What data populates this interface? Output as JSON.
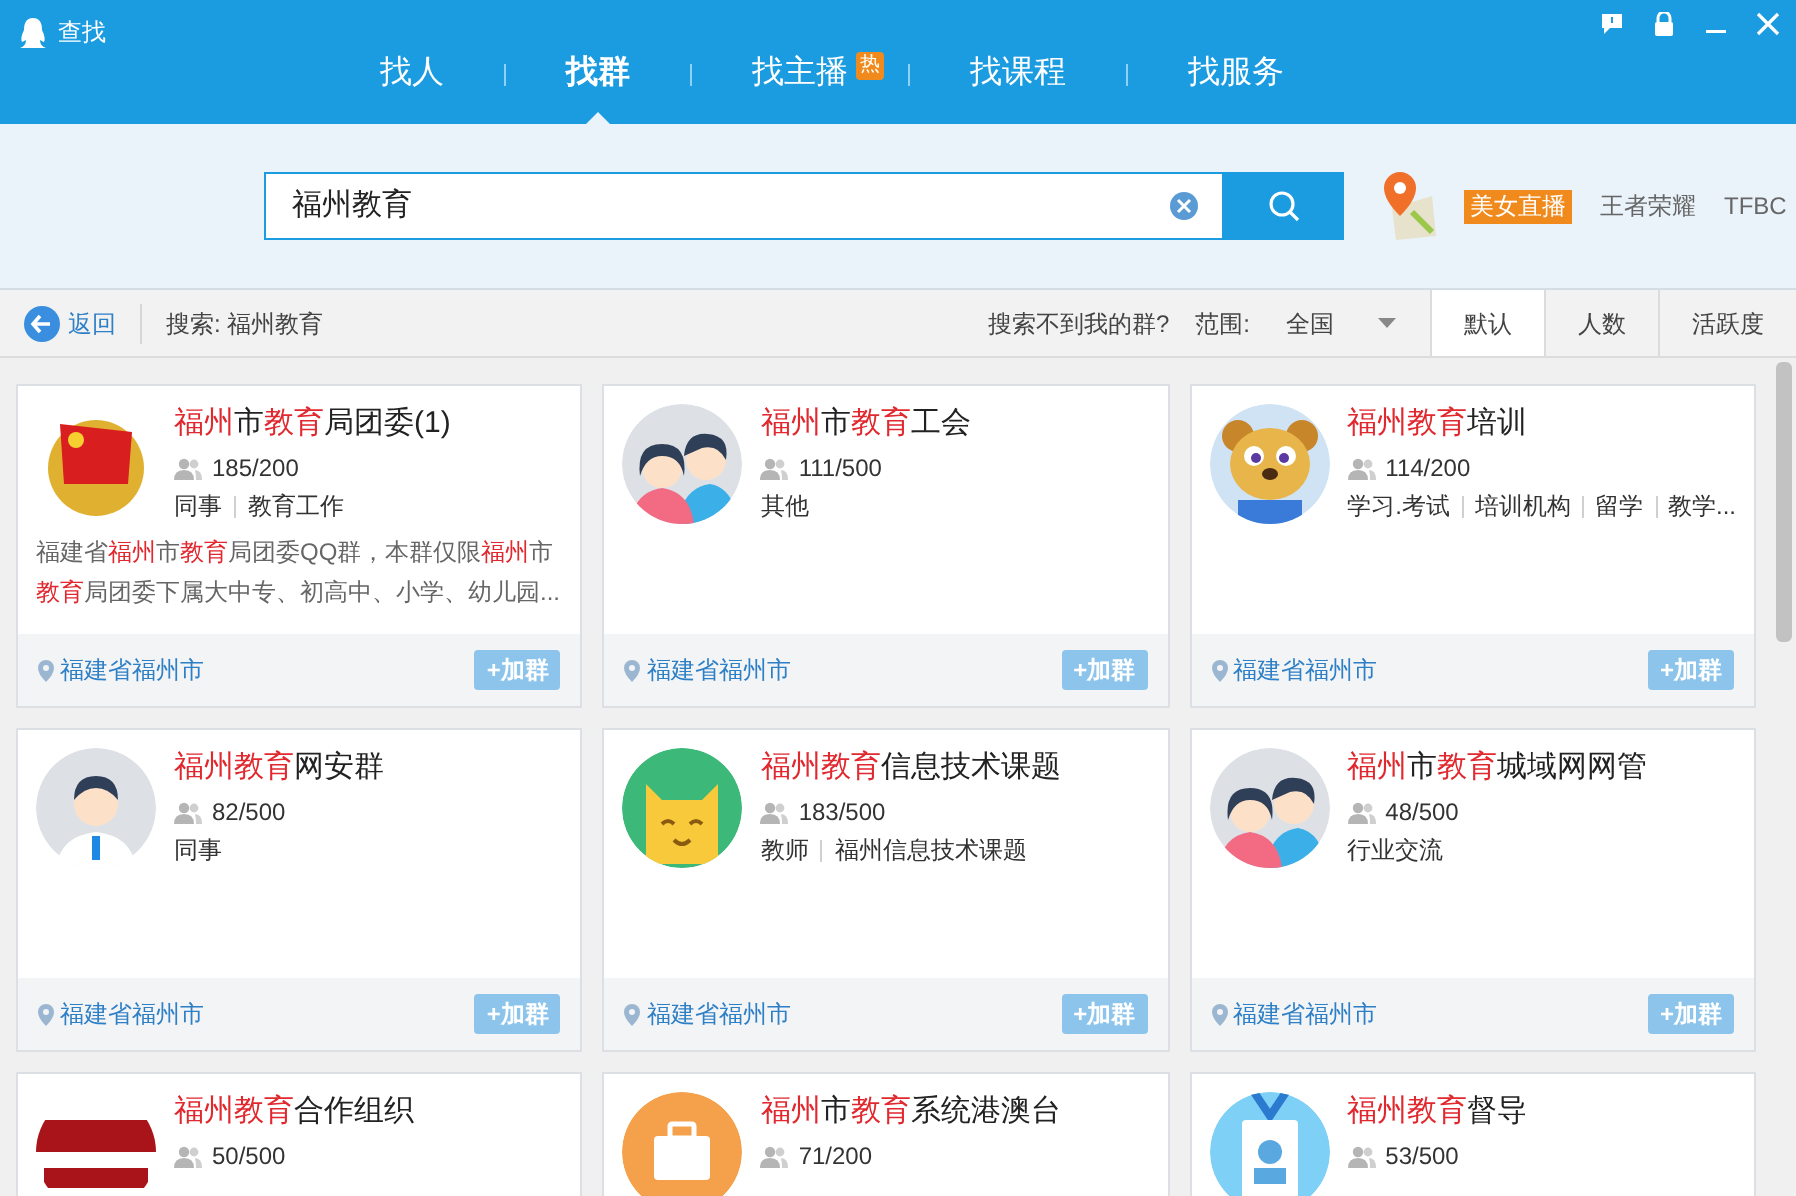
{
  "window": {
    "title": "查找"
  },
  "tabs": [
    {
      "label": "找人",
      "selected": false
    },
    {
      "label": "找群",
      "selected": true
    },
    {
      "label": "找主播",
      "selected": false,
      "badge": "热"
    },
    {
      "label": "找课程",
      "selected": false
    },
    {
      "label": "找服务",
      "selected": false
    }
  ],
  "search": {
    "value": "福州教育"
  },
  "hot": [
    {
      "label": "美女直播",
      "kind": "tag"
    },
    {
      "label": "王者荣耀",
      "kind": "link"
    },
    {
      "label": "TFBC",
      "kind": "link"
    }
  ],
  "toolbar": {
    "back": "返回",
    "query": "搜索: 福州教育",
    "help": "搜索不到我的群?",
    "range_label": "范围:",
    "range_value": "全国",
    "sorts": [
      {
        "label": "默认",
        "selected": true
      },
      {
        "label": "人数",
        "selected": false
      },
      {
        "label": "活跃度",
        "selected": false
      }
    ]
  },
  "groups": [
    {
      "kind": "emblem",
      "name": [
        {
          "text": "福州",
          "hl": true
        },
        {
          "text": "市",
          "hl": false
        },
        {
          "text": "教育",
          "hl": true
        },
        {
          "text": "局团委(1)",
          "hl": false
        }
      ],
      "members": "185/200",
      "tags": [
        "同事",
        "教育工作"
      ],
      "desc": [
        {
          "text": "福建省",
          "hl": false
        },
        {
          "text": "福州",
          "hl": true
        },
        {
          "text": "市",
          "hl": false
        },
        {
          "text": "教育",
          "hl": true
        },
        {
          "text": "局团委QQ群，本群仅限",
          "hl": false
        },
        {
          "text": "福州",
          "hl": true
        },
        {
          "text": "市",
          "hl": false
        },
        {
          "text": "教育",
          "hl": true
        },
        {
          "text": "局团委下属大中专、初高中、小学、幼儿园...",
          "hl": false
        }
      ],
      "location": "福建省福州市",
      "join": "+加群"
    },
    {
      "kind": "couple",
      "name": [
        {
          "text": "福州",
          "hl": true
        },
        {
          "text": "市",
          "hl": false
        },
        {
          "text": "教育",
          "hl": true
        },
        {
          "text": "工会",
          "hl": false
        }
      ],
      "members": "111/500",
      "tags": [
        "其他"
      ],
      "location": "福建省福州市",
      "join": "+加群"
    },
    {
      "kind": "bear",
      "name": [
        {
          "text": "福州教育",
          "hl": true
        },
        {
          "text": "培训",
          "hl": false
        }
      ],
      "members": "114/200",
      "tags": [
        "学习.考试",
        "培训机构",
        "留学",
        "教学..."
      ],
      "location": "福建省福州市",
      "join": "+加群"
    },
    {
      "kind": "man",
      "name": [
        {
          "text": "福州教育",
          "hl": true
        },
        {
          "text": "网安群",
          "hl": false
        }
      ],
      "members": "82/500",
      "tags": [
        "同事"
      ],
      "location": "福建省福州市",
      "join": "+加群"
    },
    {
      "kind": "cat",
      "name": [
        {
          "text": "福州教育",
          "hl": true
        },
        {
          "text": "信息技术课题",
          "hl": false
        }
      ],
      "members": "183/500",
      "tags": [
        "教师",
        "福州信息技术课题"
      ],
      "location": "福建省福州市",
      "join": "+加群"
    },
    {
      "kind": "couple",
      "name": [
        {
          "text": "福州",
          "hl": true
        },
        {
          "text": "市",
          "hl": false
        },
        {
          "text": "教育",
          "hl": true
        },
        {
          "text": "城域网网管",
          "hl": false
        }
      ],
      "members": "48/500",
      "tags": [
        "行业交流"
      ],
      "location": "福建省福州市",
      "join": "+加群"
    },
    {
      "kind": "stamp",
      "name": [
        {
          "text": "福州教育",
          "hl": true
        },
        {
          "text": "合作组织",
          "hl": false
        }
      ],
      "members": "50/500"
    },
    {
      "kind": "briefcase",
      "name": [
        {
          "text": "福州",
          "hl": true
        },
        {
          "text": "市",
          "hl": false
        },
        {
          "text": "教育",
          "hl": true
        },
        {
          "text": "系统港澳台",
          "hl": false
        }
      ],
      "members": "71/200"
    },
    {
      "kind": "badge",
      "name": [
        {
          "text": "福州教育",
          "hl": true
        },
        {
          "text": "督导",
          "hl": false
        }
      ],
      "members": "53/500"
    }
  ]
}
